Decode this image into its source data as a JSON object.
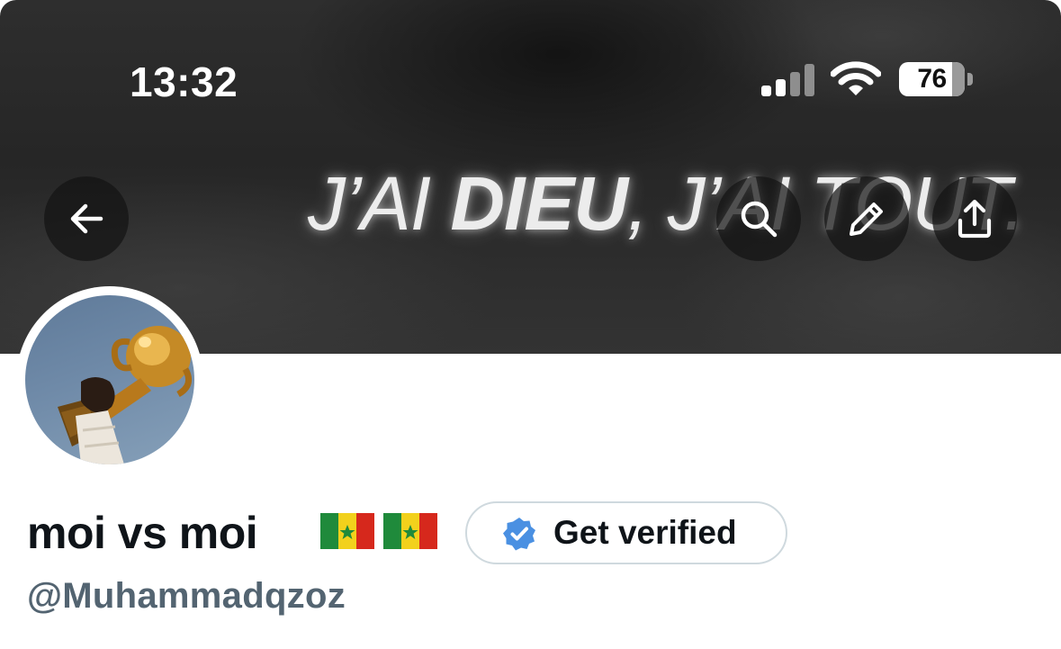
{
  "status_bar": {
    "time": "13:32",
    "battery": "76",
    "icons": [
      "cellular-signal-icon",
      "wifi-icon",
      "battery-icon"
    ]
  },
  "banner": {
    "text_light_1": "J’AI ",
    "text_bold": "DIEU",
    "text_light_2": ", J’AI TOUT."
  },
  "header_buttons": {
    "back": "arrow-left-icon",
    "search": "search-icon",
    "edit": "pencil-icon",
    "share": "share-icon"
  },
  "profile": {
    "display_name": "moi vs moi",
    "flags": [
      "senegal-flag",
      "senegal-flag"
    ],
    "verify_button_label": "Get verified",
    "handle": "@Muhammadqzoz"
  },
  "colors": {
    "verified_blue": "#4A90E2",
    "text_primary": "#0f1419",
    "text_secondary": "#536471",
    "button_border": "#cfd9de",
    "flag_green": "#1f8a3b",
    "flag_yellow": "#f2d11c",
    "flag_red": "#d6281c"
  }
}
